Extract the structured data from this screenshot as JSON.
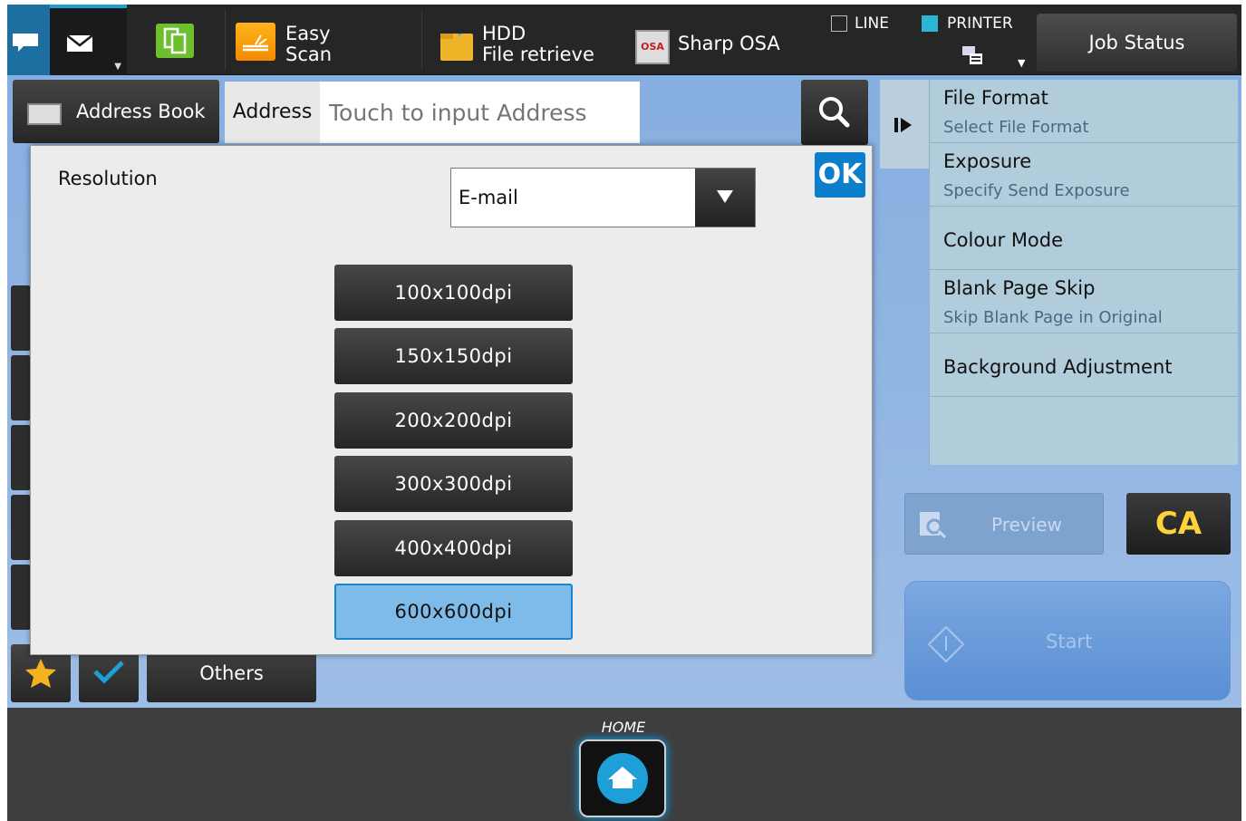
{
  "topbar": {
    "easy_scan": [
      "Easy",
      "Scan"
    ],
    "hdd": [
      "HDD",
      "File retrieve"
    ],
    "osa_icon_text": "OSA",
    "sharp_osa": "Sharp OSA",
    "line": "LINE",
    "printer": "PRINTER",
    "job_status": "Job Status"
  },
  "address": {
    "book_label": "Address Book",
    "label": "Address",
    "placeholder": "Touch to input Address"
  },
  "side_panel": [
    {
      "title": "File Format",
      "sub": "Select File Format"
    },
    {
      "title": "Exposure",
      "sub": "Specify Send Exposure"
    },
    {
      "title": "Colour Mode",
      "sub": ""
    },
    {
      "title": "Blank Page Skip",
      "sub": "Skip Blank Page in Original"
    },
    {
      "title": "Background Adjustment",
      "sub": ""
    }
  ],
  "actions": {
    "preview": "Preview",
    "ca": "CA",
    "start": "Start",
    "others": "Others"
  },
  "dialog": {
    "title": "Resolution",
    "select_value": "E-mail",
    "ok": "OK",
    "options": [
      "100x100dpi",
      "150x150dpi",
      "200x200dpi",
      "300x300dpi",
      "400x400dpi",
      "600x600dpi"
    ],
    "selected": "600x600dpi"
  },
  "bottom": {
    "home_label": "HOME"
  },
  "colors": {
    "accent": "#0b7fcc",
    "selected": "#7fbbe8",
    "ca": "#ffd23a"
  }
}
